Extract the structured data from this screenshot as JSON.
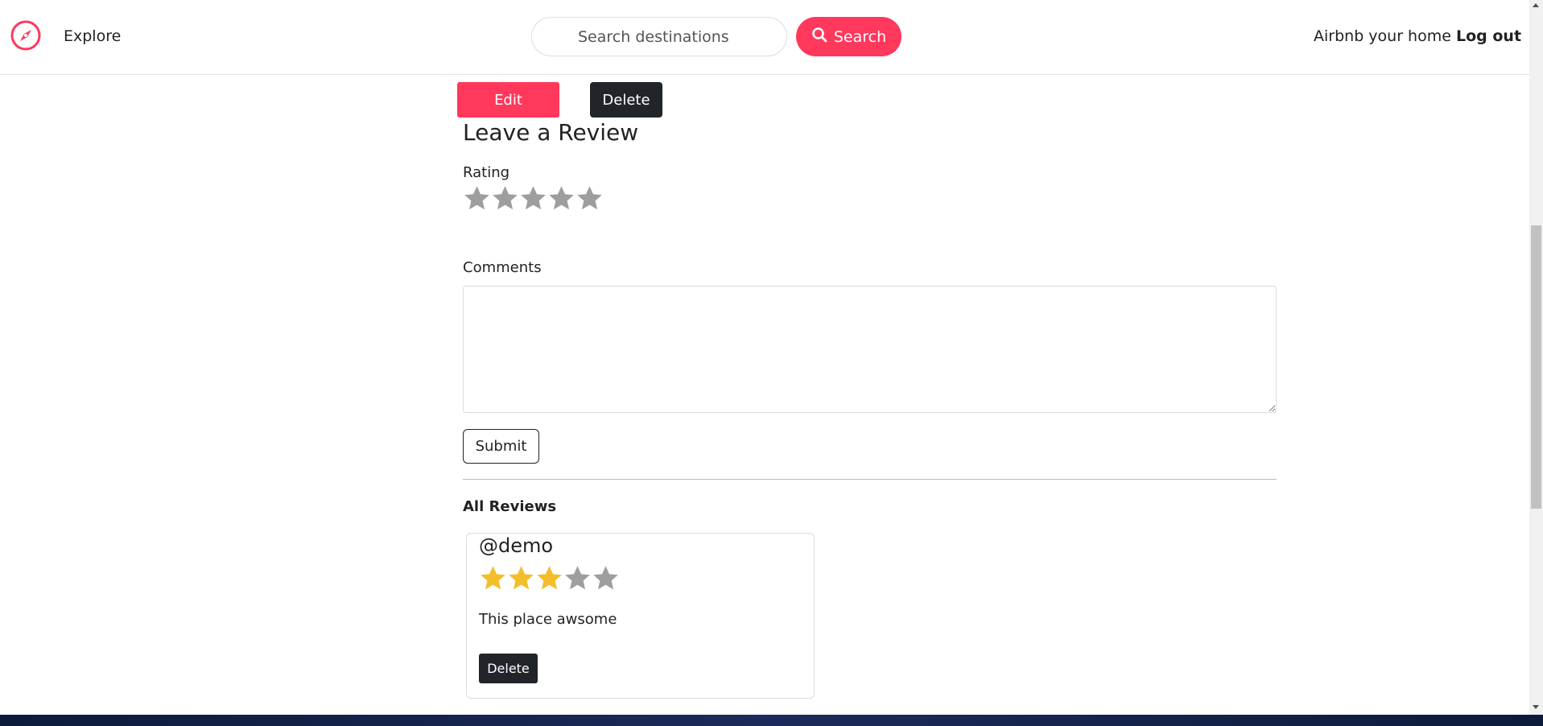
{
  "nav": {
    "logo_icon": "compass-icon",
    "explore": "Explore",
    "search_placeholder": "Search destinations",
    "search_button": "Search",
    "host_link": "Airbnb your home",
    "logout": "Log out",
    "brand_color": "#ff385c"
  },
  "listing_actions": {
    "edit": "Edit",
    "delete": "Delete"
  },
  "review_form": {
    "heading": "Leave a Review",
    "rating_label": "Rating",
    "rating_value": 0,
    "rating_max": 5,
    "comments_label": "Comments",
    "comments_value": "",
    "submit": "Submit"
  },
  "reviews": {
    "heading": "All Reviews",
    "items": [
      {
        "user": "@demo",
        "rating": 3,
        "rating_max": 5,
        "text": "This place awsome",
        "delete": "Delete"
      }
    ]
  },
  "colors": {
    "star_filled": "#f4bd2b",
    "star_empty": "#9e9e9e",
    "dark_button": "#212529"
  }
}
